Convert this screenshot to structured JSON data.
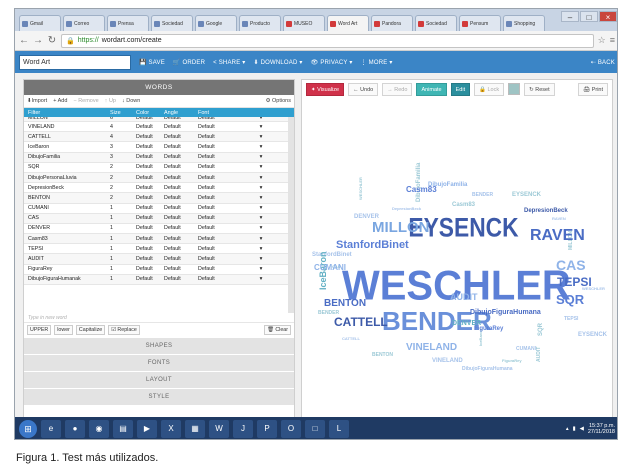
{
  "browser": {
    "tabs": [
      "Gmail",
      "Correo",
      "Prensa",
      "Sociedad",
      "Google",
      "Producto",
      "MUSEO",
      "Word Art",
      "Pandora",
      "Sociedad",
      "Pensum",
      "Shopping",
      "EL PAIS"
    ],
    "url_scheme": "https://",
    "url_rest": "wordart.com/create"
  },
  "toolbar": {
    "title_value": "Word Art",
    "save": "SAVE",
    "order": "ORDER",
    "share": "SHARE",
    "download": "DOWNLOAD",
    "privacy": "PRIVACY",
    "more": "MORE",
    "back": "BACK"
  },
  "words_panel": {
    "header": "WORDS",
    "import": "Import",
    "add": "Add",
    "remove": "Remove",
    "up": "Up",
    "down": "Down",
    "options": "Options",
    "columns": [
      "Filter",
      "Size",
      "Color",
      "Angle",
      "Font"
    ],
    "rows": [
      {
        "word": "MILLON",
        "size": "6",
        "color": "Default",
        "angle": "Default",
        "font": "Default"
      },
      {
        "word": "VINELAND",
        "size": "4",
        "color": "Default",
        "angle": "Default",
        "font": "Default"
      },
      {
        "word": "CATTELL",
        "size": "4",
        "color": "Default",
        "angle": "Default",
        "font": "Default"
      },
      {
        "word": "IceBaron",
        "size": "3",
        "color": "Default",
        "angle": "Default",
        "font": "Default"
      },
      {
        "word": "DibujoFamilia",
        "size": "3",
        "color": "Default",
        "angle": "Default",
        "font": "Default"
      },
      {
        "word": "SQR",
        "size": "2",
        "color": "Default",
        "angle": "Default",
        "font": "Default"
      },
      {
        "word": "DibujoPersonaLluvia",
        "size": "2",
        "color": "Default",
        "angle": "Default",
        "font": "Default"
      },
      {
        "word": "DepresionBeck",
        "size": "2",
        "color": "Default",
        "angle": "Default",
        "font": "Default"
      },
      {
        "word": "BENTON",
        "size": "2",
        "color": "Default",
        "angle": "Default",
        "font": "Default"
      },
      {
        "word": "CUMANI",
        "size": "1",
        "color": "Default",
        "angle": "Default",
        "font": "Default"
      },
      {
        "word": "CAS",
        "size": "1",
        "color": "Default",
        "angle": "Default",
        "font": "Default"
      },
      {
        "word": "DENVER",
        "size": "1",
        "color": "Default",
        "angle": "Default",
        "font": "Default"
      },
      {
        "word": "Casm83",
        "size": "1",
        "color": "Default",
        "angle": "Default",
        "font": "Default"
      },
      {
        "word": "TEPSI",
        "size": "1",
        "color": "Default",
        "angle": "Default",
        "font": "Default"
      },
      {
        "word": "AUDIT",
        "size": "1",
        "color": "Default",
        "angle": "Default",
        "font": "Default"
      },
      {
        "word": "FiguraRey",
        "size": "1",
        "color": "Default",
        "angle": "Default",
        "font": "Default"
      },
      {
        "word": "DibujoFiguraHumanak",
        "size": "1",
        "color": "Default",
        "angle": "Default",
        "font": "Default"
      }
    ],
    "new_word_placeholder": "Type in new word",
    "case_buttons": {
      "upper": "UPPER",
      "lower": "lower",
      "capitalize": "Capitalize",
      "replace": "Replace",
      "clear": "Clear"
    },
    "sections": [
      "SHAPES",
      "FONTS",
      "LAYOUT",
      "STYLE"
    ]
  },
  "canvas_toolbar": {
    "visualize": "Visualize",
    "undo": "Undo",
    "redo": "Redo",
    "animate": "Animate",
    "edit": "Edit",
    "lock": "Lock",
    "reset": "Reset",
    "print": "Print"
  },
  "cloud_words": {
    "weschler": "WESCHLER",
    "bender": "BENDER",
    "eysenck": "EYSENCK",
    "raven": "RAVEN",
    "millon": "MILLON",
    "stanford": "StanfordBinet",
    "cas": "CAS",
    "tepsi": "TEPSI",
    "sqr": "SQR",
    "cattell": "CATTELL",
    "benton": "BENTON",
    "vineland": "VINELAND",
    "icebaron": "IceBaron",
    "cumani": "CUMANI",
    "casm83": "Casm83",
    "depresion": "DepresionBeck",
    "audit": "AUDIT",
    "denver": "DENVER",
    "figurarey": "FiguraRey",
    "dibujofigura": "DibujoFiguraHumana",
    "dibujofamilia": "DibujoFamilia"
  },
  "colors": {
    "cloud_primary": "#5b7fd6",
    "cloud_light": "#8fb3e8",
    "cloud_teal": "#62b0c4",
    "cloud_dark": "#3d5aa8"
  },
  "taskbar": {
    "time": "15:37 p.m.",
    "date": "27/11/2018"
  },
  "caption": "Figura 1. Test más utilizados."
}
